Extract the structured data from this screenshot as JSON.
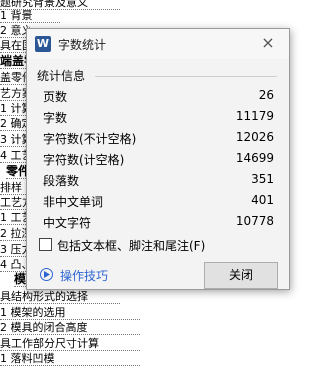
{
  "document": {
    "lines": [
      "题研究背景及意义",
      "1 背景",
      "2 意义",
      "具在国",
      "端盖零",
      "盖零件",
      "艺方案",
      "1 计算",
      "2 确定",
      "3 计算",
      "4 工艺",
      "零件",
      "排样",
      "工艺方",
      "1 工艺",
      "2 拉深",
      "3 压力",
      "4 凸、",
      "模具",
      "具结构形式的选择",
      "1 模架的选用",
      "2 模具的闭合高度",
      "具工作部分尺寸计算",
      "1 落料凹模"
    ]
  },
  "dialog": {
    "app_icon_glyph": "W",
    "title": "字数统计",
    "close_glyph": "×",
    "section_title": "统计信息",
    "stats": [
      {
        "label": "页数",
        "value": "26"
      },
      {
        "label": "字数",
        "value": "11179"
      },
      {
        "label": "字符数(不计空格)",
        "value": "12026"
      },
      {
        "label": "字符数(计空格)",
        "value": "14699"
      },
      {
        "label": "段落数",
        "value": "351"
      },
      {
        "label": "非中文单词",
        "value": "401"
      },
      {
        "label": "中文字符",
        "value": "10778"
      }
    ],
    "checkbox_label": "包括文本框、脚注和尾注(F)",
    "tips_label": "操作技巧",
    "close_button_label": "关闭"
  }
}
